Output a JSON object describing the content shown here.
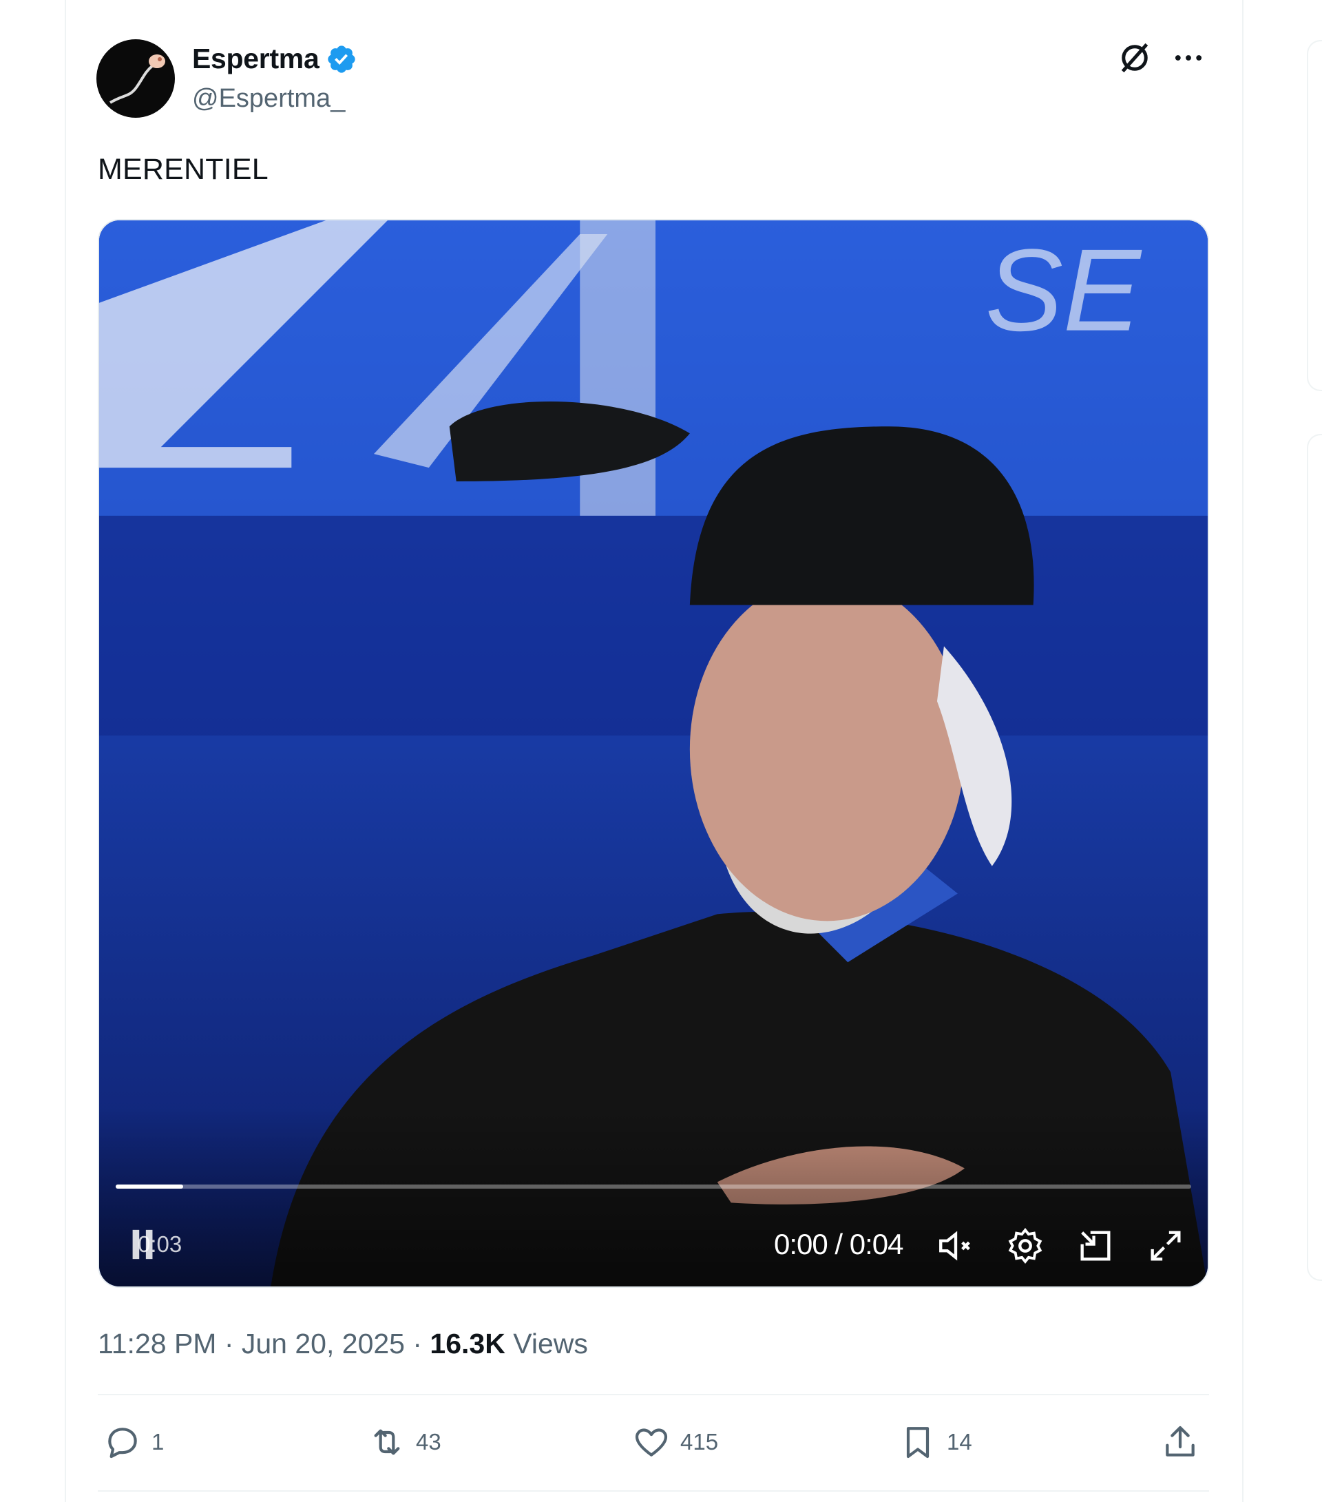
{
  "tweet": {
    "display_name": "Espertma",
    "handle": "@Espertma_",
    "text": "MERENTIEL",
    "timestamp": "11:28 PM · Jun 20, 2025 · ",
    "views_count": "16.3K",
    "views_label": "Views"
  },
  "video": {
    "elapsed_badge": "0:03",
    "time_readout": "0:00 / 0:04",
    "progress": 0.063
  },
  "actions": {
    "replies": "1",
    "reposts": "43",
    "likes": "415",
    "bookmarks": "14"
  },
  "icons": [
    "verified-badge-icon",
    "grok-icon",
    "more-icon",
    "pause-icon",
    "mute-icon",
    "settings-icon",
    "pip-icon",
    "fullscreen-icon",
    "reply-icon",
    "repost-icon",
    "like-icon",
    "bookmark-icon",
    "share-icon"
  ],
  "colors": {
    "verified": "#1d9bf0",
    "secondary_text": "#536471",
    "primary_text": "#0f1419"
  }
}
